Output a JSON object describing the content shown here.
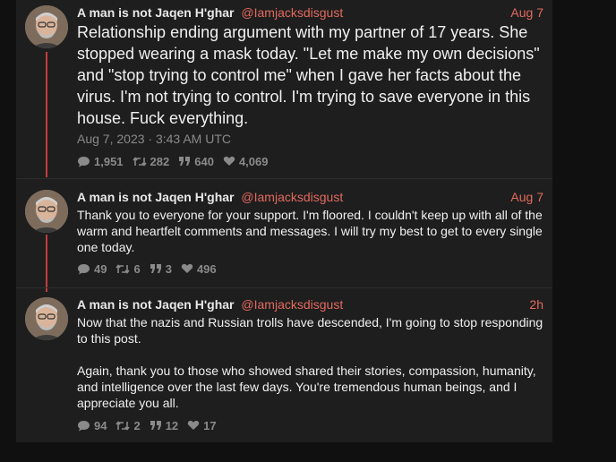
{
  "tweets": [
    {
      "name": "A man is not Jaqen H'ghar",
      "handle": "@Iamjacksdisgust",
      "date": "Aug 7",
      "text": "Relationship ending argument with my partner of 17 years. She stopped wearing a mask today. \"Let me make my own decisions\" and \"stop trying to control me\" when I gave her facts about the virus. I'm not trying to control. I'm trying to save everyone in this house. Fuck everything.",
      "timestamp": "Aug 7, 2023 · 3:43 AM UTC",
      "replies": "1,951",
      "retweets": "282",
      "quotes": "640",
      "likes": "4,069"
    },
    {
      "name": "A man is not Jaqen H'ghar",
      "handle": "@Iamjacksdisgust",
      "date": "Aug 7",
      "text": "Thank you to everyone for your support. I'm floored. I couldn't keep up with all of the warm and heartfelt comments and messages. I will try my best to get to every single one today.",
      "replies": "49",
      "retweets": "6",
      "quotes": "3",
      "likes": "496"
    },
    {
      "name": "A man is not Jaqen H'ghar",
      "handle": "@Iamjacksdisgust",
      "date": "2h",
      "text_p1": "Now that the nazis and Russian trolls have descended, I'm going to stop responding to this post.",
      "text_p2": "Again, thank you to those who showed shared their stories, compassion, humanity, and intelligence over the last few days. You're tremendous human beings, and I appreciate you all.",
      "replies": "94",
      "retweets": "2",
      "quotes": "12",
      "likes": "17"
    }
  ],
  "icons": {
    "reply": "reply-icon",
    "retweet": "retweet-icon",
    "quote": "quote-icon",
    "like": "heart-icon"
  },
  "colors": {
    "accent": "#e36a5e",
    "thread_line": "#c43c3c",
    "panel": "#1e1e1e",
    "background": "#101010",
    "muted": "#8a8a8a"
  }
}
